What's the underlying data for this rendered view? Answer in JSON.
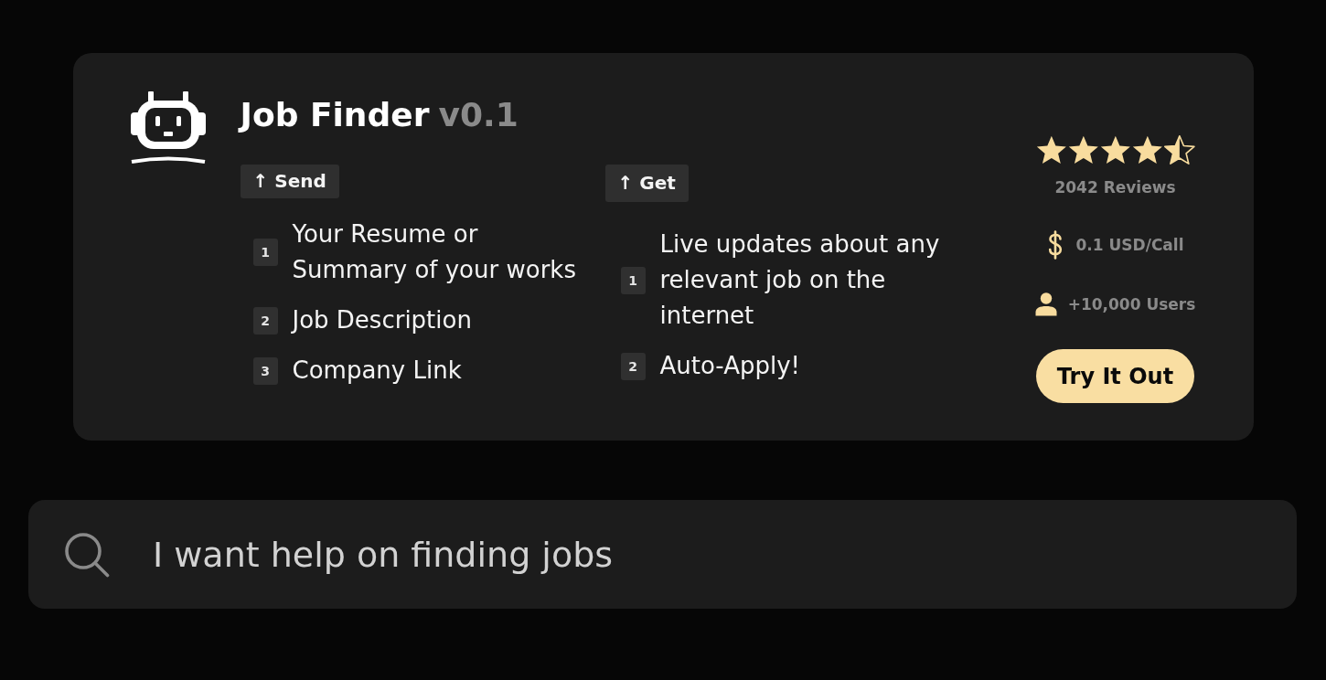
{
  "app": {
    "name": "Job Finder",
    "version": "v0.1"
  },
  "sections": [
    {
      "label": "↑ Send",
      "items": [
        {
          "number": "1",
          "text": "Your Resume or Summary of your works"
        },
        {
          "number": "2",
          "text": "Job Description"
        },
        {
          "number": "3",
          "text": "Company Link"
        }
      ]
    },
    {
      "label": "↑ Get",
      "items": [
        {
          "number": "1",
          "text": "Live updates about any relevant job on the internet"
        },
        {
          "number": "2",
          "text": "Auto-Apply!"
        }
      ]
    }
  ],
  "rating": {
    "stars": 4.5,
    "reviews": "2042 Reviews"
  },
  "price": "0.1 USD/Call",
  "users": "+10,000 Users",
  "cta": "Try It Out",
  "search": {
    "value": "I want help on finding jobs"
  }
}
